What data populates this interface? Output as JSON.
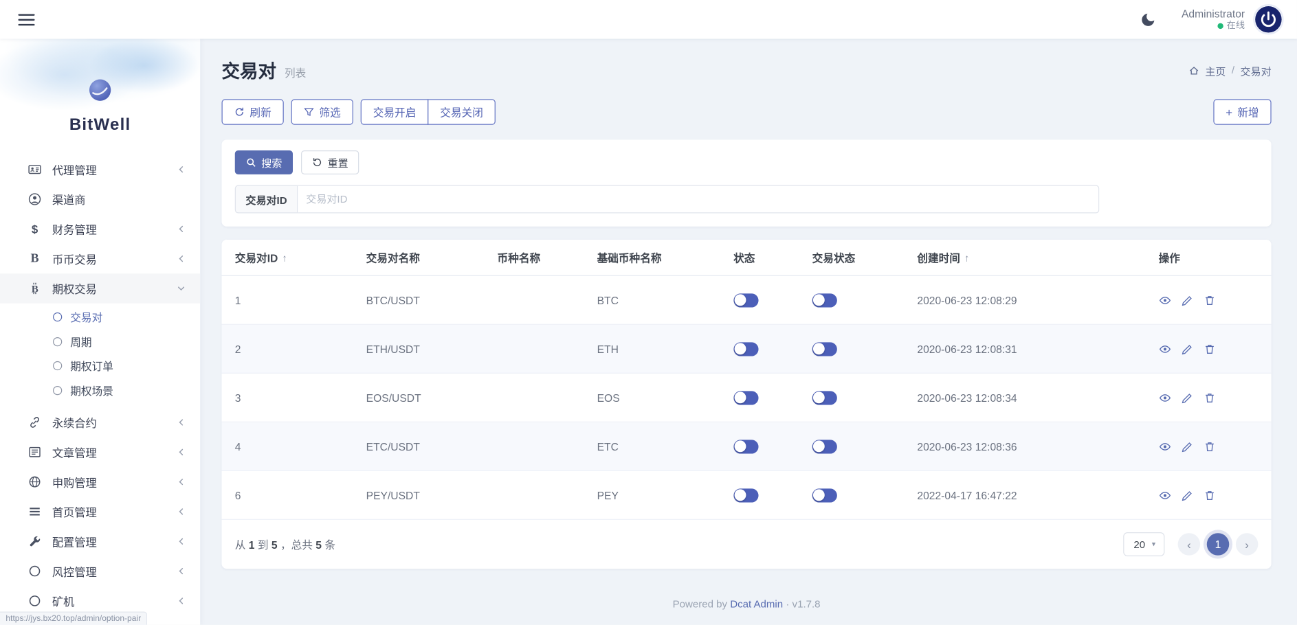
{
  "navbar": {
    "user_name": "Administrator",
    "user_status": "在线"
  },
  "sidebar": {
    "brand": "BitWell",
    "items": [
      {
        "key": "agent-management",
        "label": "代理管理",
        "icon": "id-card",
        "chevron": "left"
      },
      {
        "key": "channel-merchant",
        "label": "渠道商",
        "icon": "user-circle",
        "chevron": ""
      },
      {
        "key": "finance-management",
        "label": "财务管理",
        "icon": "dollar",
        "chevron": "left"
      },
      {
        "key": "spot-trading",
        "label": "币币交易",
        "icon": "letter-b",
        "chevron": "left"
      },
      {
        "key": "option-trading",
        "label": "期权交易",
        "icon": "bitcoin",
        "chevron": "down",
        "active": true,
        "children": [
          {
            "key": "trading-pair",
            "label": "交易对",
            "active": true
          },
          {
            "key": "period",
            "label": "周期",
            "active": false
          },
          {
            "key": "option-order",
            "label": "期权订单",
            "active": false
          },
          {
            "key": "option-scene",
            "label": "期权场景",
            "active": false
          }
        ]
      },
      {
        "key": "perpetual-contract",
        "label": "永续合约",
        "icon": "link",
        "chevron": "left"
      },
      {
        "key": "article-management",
        "label": "文章管理",
        "icon": "article",
        "chevron": "left"
      },
      {
        "key": "subscription-management",
        "label": "申购管理",
        "icon": "globe",
        "chevron": "left"
      },
      {
        "key": "homepage-management",
        "label": "首页管理",
        "icon": "list",
        "chevron": "left"
      },
      {
        "key": "config-management",
        "label": "配置管理",
        "icon": "wrench",
        "chevron": "left"
      },
      {
        "key": "risk-management",
        "label": "风控管理",
        "icon": "circle",
        "chevron": "left"
      },
      {
        "key": "mining-machine",
        "label": "矿机",
        "icon": "circle",
        "chevron": "left"
      }
    ]
  },
  "status_url": "https://jys.bx20.top/admin/option-pair",
  "page_header": {
    "title": "交易对",
    "subtitle": "列表",
    "breadcrumb_home": "主页",
    "breadcrumb_separator": "/",
    "breadcrumb_current": "交易对"
  },
  "toolbar": {
    "refresh": "刷新",
    "filter": "筛选",
    "trade_open": "交易开启",
    "trade_close": "交易关闭",
    "add": "新增"
  },
  "search_panel": {
    "search": "搜索",
    "reset": "重置",
    "field_label": "交易对ID",
    "field_placeholder": "交易对ID"
  },
  "table": {
    "headers": [
      {
        "label": "交易对ID",
        "sort": true
      },
      {
        "label": "交易对名称",
        "sort": false
      },
      {
        "label": "币种名称",
        "sort": false
      },
      {
        "label": "基础币种名称",
        "sort": false
      },
      {
        "label": "状态",
        "sort": false
      },
      {
        "label": "交易状态",
        "sort": false
      },
      {
        "label": "创建时间",
        "sort": true
      },
      {
        "label": "操作",
        "sort": false
      }
    ],
    "rows": [
      {
        "id": "1",
        "pair_name": "BTC/USDT",
        "coin_name": "",
        "base_coin": "BTC",
        "status_on": true,
        "trade_on": true,
        "created_at": "2020-06-23 12:08:29"
      },
      {
        "id": "2",
        "pair_name": "ETH/USDT",
        "coin_name": "",
        "base_coin": "ETH",
        "status_on": true,
        "trade_on": true,
        "created_at": "2020-06-23 12:08:31"
      },
      {
        "id": "3",
        "pair_name": "EOS/USDT",
        "coin_name": "",
        "base_coin": "EOS",
        "status_on": true,
        "trade_on": true,
        "created_at": "2020-06-23 12:08:34"
      },
      {
        "id": "4",
        "pair_name": "ETC/USDT",
        "coin_name": "",
        "base_coin": "ETC",
        "status_on": true,
        "trade_on": true,
        "created_at": "2020-06-23 12:08:36"
      },
      {
        "id": "6",
        "pair_name": "PEY/USDT",
        "coin_name": "",
        "base_coin": "PEY",
        "status_on": true,
        "trade_on": true,
        "created_at": "2022-04-17 16:47:22"
      }
    ],
    "summary": {
      "t1": "从",
      "from": "1",
      "t2": "到",
      "to": "5",
      "t3": "，总共",
      "total": "5",
      "t4": "条"
    },
    "page_size": "20",
    "current_page": "1"
  },
  "footer": {
    "powered_by": "Powered by",
    "link": "Dcat Admin",
    "dot": "·",
    "version": "v1.7.8"
  },
  "icons": {
    "sort_asc": "↑",
    "caret_down": "▾",
    "prev": "‹",
    "next": "›",
    "plus": "+"
  },
  "colors": {
    "primary": "#586cb1",
    "online": "#21b978",
    "body_bg": "#eff3f8"
  }
}
